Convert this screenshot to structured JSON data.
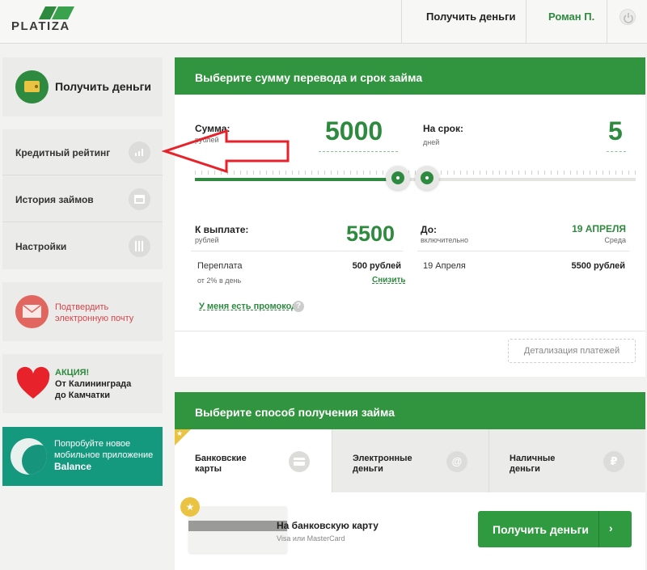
{
  "header": {
    "logo_text": "PLATIZA",
    "get_money_link": "Получить деньги",
    "user_name": "Роман П."
  },
  "sidebar": {
    "get_money_label": "Получить деньги",
    "menu": [
      {
        "label": "Кредитный рейтинг",
        "icon": "chart-bars-icon"
      },
      {
        "label": "История займов",
        "icon": "window-icon"
      },
      {
        "label": "Настройки",
        "icon": "sliders-icon"
      }
    ],
    "email_confirm": {
      "line1": "Подтвердить",
      "line2": "электронную почту"
    },
    "promo": {
      "title": "АКЦИЯ!",
      "line1": "От Калининграда",
      "line2": "до Камчатки"
    },
    "app_promo": {
      "line1": "Попробуйте новое",
      "line2": "мобильное приложение",
      "line3": "Balance"
    }
  },
  "loan_card": {
    "title": "Выберите сумму перевода и срок займа",
    "amount_label": "Сумма:",
    "amount_unit": "рублей",
    "amount_value": "5000",
    "term_label": "На срок:",
    "term_unit": "дней",
    "term_value": "5",
    "amount_slider_fraction": 0.46,
    "term_slider_fraction": 0.51,
    "payout_label": "К выплате:",
    "payout_unit": "рублей",
    "payout_value": "5500",
    "until_label": "До:",
    "until_sub": "включительно",
    "until_date": "19 АПРЕЛЯ",
    "until_weekday": "Среда",
    "overpay_label": "Переплата",
    "overpay_rate": "от 2% в день",
    "overpay_value": "500 рублей",
    "reduce_link": "Снизить",
    "schedule_date": "19 Апреля",
    "schedule_amount": "5500 рублей",
    "promo_link": "У меня есть промокод",
    "details_button": "Детализация платежей"
  },
  "method_card": {
    "title": "Выберите способ получения займа",
    "tabs": [
      {
        "line1": "Банковские",
        "line2": "карты",
        "icon": "card-icon"
      },
      {
        "line1": "Электронные",
        "line2": "деньги",
        "icon": "at-icon"
      },
      {
        "line1": "Наличные",
        "line2": "деньги",
        "icon": "ruble-icon"
      }
    ],
    "to_card_title": "На банковскую карту",
    "to_card_sub": "Visa или MasterCard",
    "submit_label": "Получить деньги",
    "submit_arrow": "›"
  },
  "colors": {
    "brand_green": "#31943f",
    "accent_red": "#e8222b",
    "app_teal": "#14987e",
    "star_yellow": "#e9c341"
  }
}
